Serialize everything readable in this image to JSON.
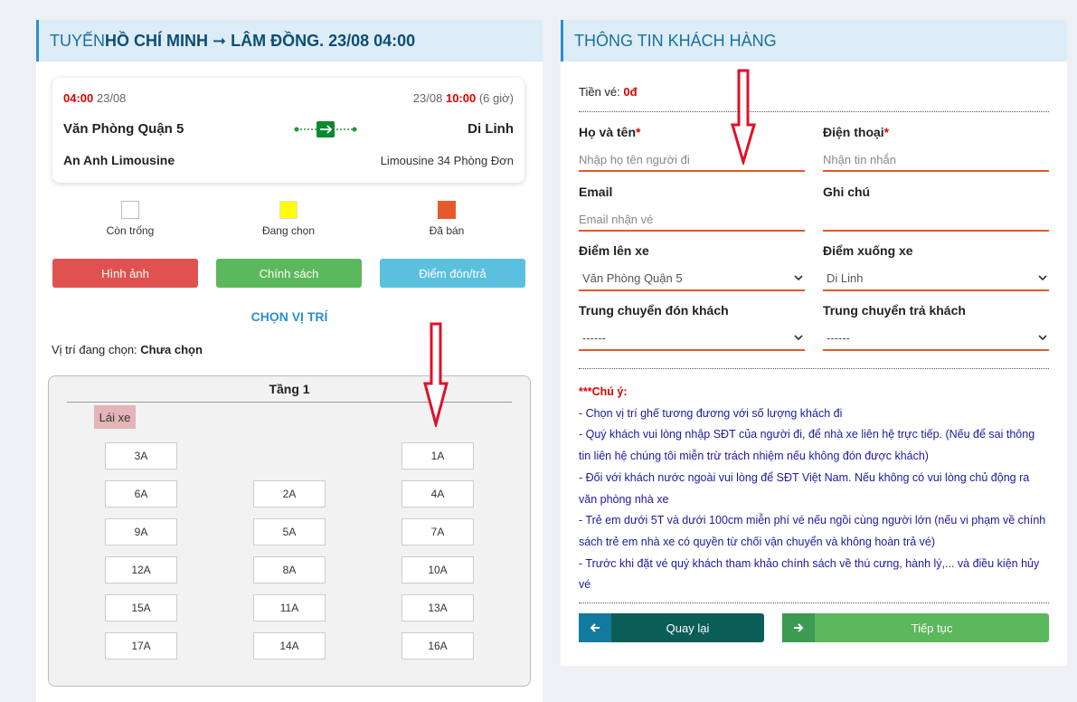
{
  "left": {
    "header_prefix": "TUYẾN ",
    "header_route": "HỒ CHÍ MINH ➞ LÂM ĐỒNG",
    "header_suffix": ". 23/08 04:00",
    "trip": {
      "depart_time": "04:00",
      "depart_date": "23/08",
      "arrive_date": "23/08",
      "arrive_time": "10:00",
      "duration": "(6 giờ)",
      "origin": "Văn Phòng Quận 5",
      "destination": "Di Linh",
      "operator": "An Anh Limousine",
      "vehicle": "Limousine 34 Phòng Đơn"
    },
    "legend": [
      {
        "label": "Còn trống",
        "color": "#ffffff"
      },
      {
        "label": "Đang chọn",
        "color": "#ffff00"
      },
      {
        "label": "Đã bán",
        "color": "#e55a2b"
      }
    ],
    "buttons": {
      "images": "Hình ảnh",
      "policy": "Chính sách",
      "pickup": "Điểm đón/trả"
    },
    "choose_position": "CHỌN VỊ TRÍ",
    "selected_label": "Vị trí đang chọn: ",
    "selected_value": "Chưa chọn",
    "floor": "Tầng 1",
    "driver": "Lái xe",
    "seats": {
      "s3A": "3A",
      "s1A": "1A",
      "s6A": "6A",
      "s2A": "2A",
      "s4A": "4A",
      "s9A": "9A",
      "s5A": "5A",
      "s7A": "7A",
      "s12A": "12A",
      "s8A": "8A",
      "s10A": "10A",
      "s15A": "15A",
      "s11A": "11A",
      "s13A": "13A",
      "s17A": "17A",
      "s14A": "14A",
      "s16A": "16A"
    }
  },
  "right": {
    "header": "THÔNG TIN KHÁCH HÀNG",
    "price_label": "Tiền vé: ",
    "price_value": "0đ",
    "name_label": "Họ và tên",
    "name_placeholder": "Nhập họ tên người đi",
    "phone_label": "Điện thoại",
    "phone_placeholder": "Nhận tin nhắn",
    "required_mark": "*",
    "email_label": "Email",
    "email_placeholder": "Email nhận vé",
    "note_label": "Ghi chú",
    "pickup_label": "Điểm lên xe",
    "pickup_value": "Văn Phòng Quận 5",
    "dropoff_label": "Điểm xuống xe",
    "dropoff_value": "Di Linh",
    "transfer_pick_label": "Trung chuyển đón khách",
    "transfer_pick_value": "------",
    "transfer_drop_label": "Trung chuyển trả khách",
    "transfer_drop_value": "------",
    "notes_title": "***Chú ý:",
    "notes": [
      "- Chọn vị trí ghế tương đương với số lượng khách đi",
      "- Quý khách vui lòng nhập SĐT của người đi, để nhà xe liên hệ trực tiếp. (Nếu để sai thông tin liên hệ chúng tôi miễn trừ trách nhiệm nếu không đón được khách)",
      "- Đối với khách nước ngoài vui lòng để SĐT Việt Nam. Nếu không có vui lòng chủ động ra văn phòng nhà xe",
      "- Trẻ em dưới 5T và dưới 100cm miễn phí vé nếu ngồi cùng người lớn (nếu vi phạm về chính sách trẻ em nhà xe có quyền từ chối vận chuyển và không hoàn trả vé)",
      "- Trước khi đặt vé quý khách tham khảo chính sách về thú cưng, hành lý,... và điều kiện hủy vé"
    ],
    "back_label": "Quay lại",
    "next_label": "Tiếp tục"
  },
  "colors": {
    "accent_blue": "#2b8fd1",
    "input_border": "#e05a2b",
    "btn_red": "#e0524f",
    "btn_green": "#5cb85c",
    "btn_cyan": "#5bc0de",
    "btn_dark_teal": "#0b5e57",
    "annotation_red": "#e0102a"
  },
  "icons": [
    "bus-route-icon",
    "chevron-down-icon",
    "arrow-left-icon",
    "arrow-right-icon",
    "down-arrow-annotation"
  ]
}
